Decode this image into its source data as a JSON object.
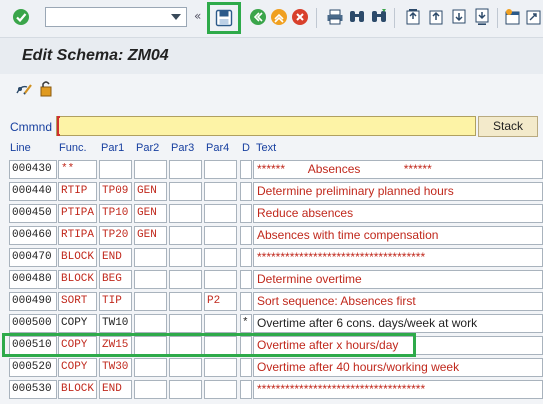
{
  "toolbar": {
    "command_field_value": "",
    "icons": [
      "check-icon",
      "save-icon",
      "back-icon",
      "exit-icon",
      "cancel-icon",
      "print-icon",
      "find-icon",
      "find-next-icon",
      "first-page-icon",
      "previous-page-icon",
      "next-page-icon",
      "last-page-icon",
      "create-session-icon",
      "shortcut-icon"
    ]
  },
  "title": "Edit Schema: ZM04",
  "command": {
    "label": "Cmmnd",
    "value": "",
    "button": "Stack"
  },
  "columns": {
    "line": "Line",
    "func": "Func.",
    "par1": "Par1",
    "par2": "Par2",
    "par3": "Par3",
    "par4": "Par4",
    "d": "D",
    "text": "Text"
  },
  "rows": [
    {
      "line": "000430",
      "func": "**",
      "par1": "",
      "par2": "",
      "par3": "",
      "par4": "",
      "d": "",
      "text": "******       Absences             ******"
    },
    {
      "line": "000440",
      "func": "RTIP",
      "par1": "TP09",
      "par2": "GEN",
      "par3": "",
      "par4": "",
      "d": "",
      "text": "Determine preliminary planned hours"
    },
    {
      "line": "000450",
      "func": "PTIPA",
      "par1": "TP10",
      "par2": "GEN",
      "par3": "",
      "par4": "",
      "d": "",
      "text": "Reduce absences"
    },
    {
      "line": "000460",
      "func": "RTIPA",
      "par1": "TP20",
      "par2": "GEN",
      "par3": "",
      "par4": "",
      "d": "",
      "text": "Absences with time compensation"
    },
    {
      "line": "000470",
      "func": "BLOCK",
      "par1": "END",
      "par2": "",
      "par3": "",
      "par4": "",
      "d": "",
      "text": "************************************"
    },
    {
      "line": "000480",
      "func": "BLOCK",
      "par1": "BEG",
      "par2": "",
      "par3": "",
      "par4": "",
      "d": "",
      "text": "Determine overtime"
    },
    {
      "line": "000490",
      "func": "SORT",
      "par1": "TIP",
      "par2": "",
      "par3": "",
      "par4": "P2",
      "d": "",
      "text": "Sort sequence: Absences first"
    },
    {
      "line": "000500",
      "func": "COPY",
      "par1": "TW10",
      "par2": "",
      "par3": "",
      "par4": "",
      "d": "*",
      "text": "Overtime after 6 cons. days/week at work"
    },
    {
      "line": "000510",
      "func": "COPY",
      "par1": "ZW15",
      "par2": "",
      "par3": "",
      "par4": "",
      "d": "",
      "text": "Overtime after x hours/day"
    },
    {
      "line": "000520",
      "func": "COPY",
      "par1": "TW30",
      "par2": "",
      "par3": "",
      "par4": "",
      "d": "",
      "text": "Overtime after 40 hours/working week"
    },
    {
      "line": "000530",
      "func": "BLOCK",
      "par1": "END",
      "par2": "",
      "par3": "",
      "par4": "",
      "d": "",
      "text": "************************************"
    }
  ],
  "row_colors": [
    "#c0281c",
    "#c0281c",
    "#c0281c",
    "#c0281c",
    "#c0281c",
    "#c0281c",
    "#c0281c",
    "#222222",
    "#c0281c",
    "#c0281c",
    "#c0281c"
  ],
  "colors": {
    "accent_highlight": "#2eaa4a",
    "header_blue": "#1840a0",
    "command_bg": "#fdf3a6"
  }
}
